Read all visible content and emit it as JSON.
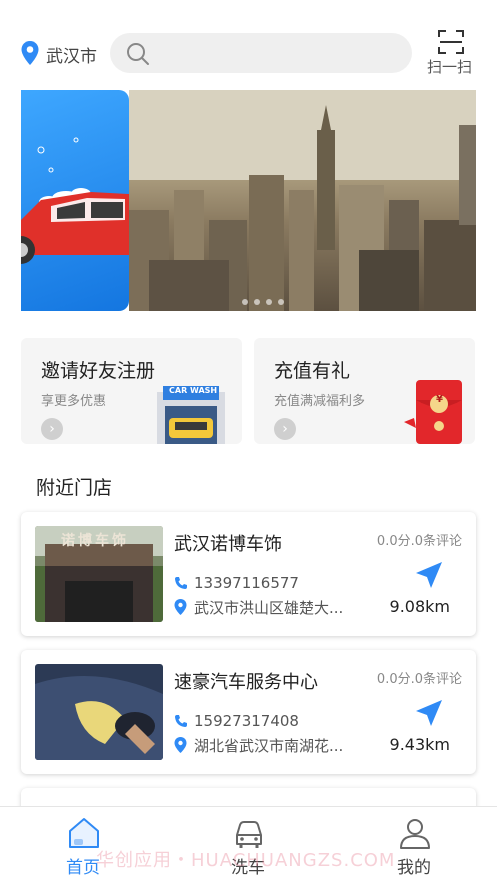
{
  "header": {
    "city": "武汉市",
    "search_placeholder": "",
    "scan_label": "扫一扫"
  },
  "promos": [
    {
      "title": "邀请好友注册",
      "subtitle": "享更多优惠",
      "sign": "CAR WASH"
    },
    {
      "title": "充值有礼",
      "subtitle": "充值满减福利多",
      "badge": "¥"
    }
  ],
  "section": {
    "title": "附近门店"
  },
  "stores": [
    {
      "name": "武汉诺博车饰",
      "phone": "13397116577",
      "address": "武汉市洪山区雄楚大...",
      "rating": "0.0分.0条评论",
      "distance": "9.08km",
      "sign_text": "诺博车饰"
    },
    {
      "name": "速豪汽车服务中心",
      "phone": "15927317408",
      "address": "湖北省武汉市南湖花...",
      "rating": "0.0分.0条评论",
      "distance": "9.43km"
    }
  ],
  "tabs": [
    {
      "label": "首页",
      "icon": "home-icon",
      "active": true
    },
    {
      "label": "洗车",
      "icon": "car-icon",
      "active": false
    },
    {
      "label": "我的",
      "icon": "user-icon",
      "active": false
    }
  ],
  "watermark": "华创应用・HUACHUANGZS.COM",
  "colors": {
    "accent": "#2f8af5",
    "card_bg": "#f5f5f5",
    "banner_blue": "#1e88f0"
  }
}
